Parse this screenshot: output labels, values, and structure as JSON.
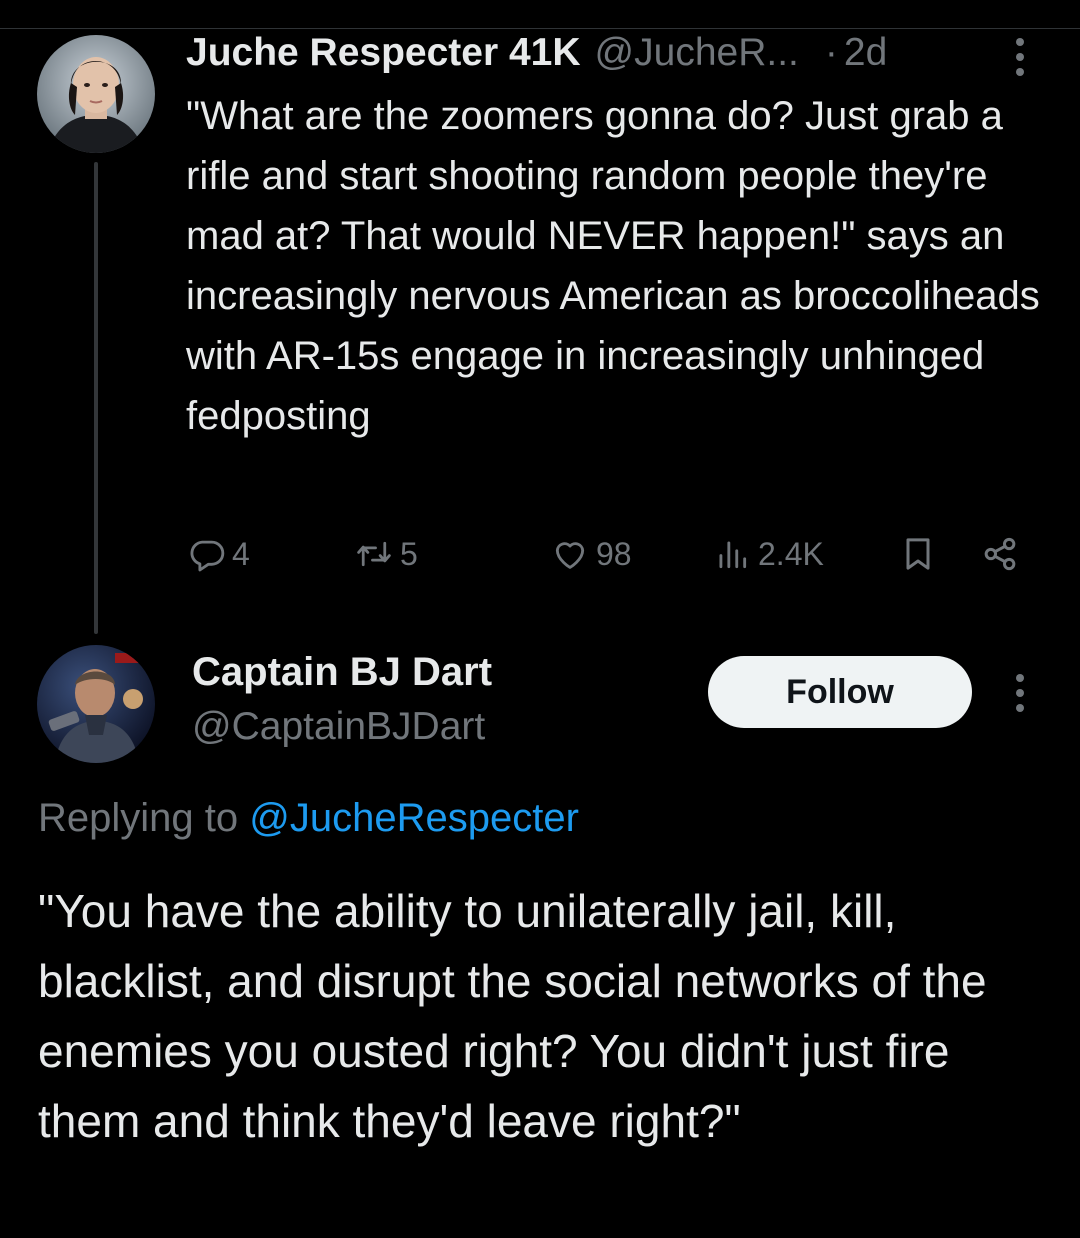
{
  "tweet1": {
    "author_name": "Juche Respecter 41K",
    "handle": "@JucheR...",
    "separator": "·",
    "time": "2d",
    "avatar_icon": "user-avatar-photo",
    "text": "\"What are the zoomers gonna do? Just grab a rifle and start shooting random people they're mad at? That would NEVER happen!\" says an increasingly nervous American as broccoliheads with AR-15s engage in increasingly unhinged fedposting",
    "stats": {
      "replies": "4",
      "reposts": "5",
      "likes": "98",
      "views": "2.4K"
    }
  },
  "tweet2": {
    "author_name": "Captain BJ Dart",
    "handle": "@CaptainBJDart",
    "avatar_icon": "user-avatar-photo",
    "follow_label": "Follow",
    "replying_prefix": "Replying to",
    "replying_to": "@JucheRespecter",
    "text": "\"You have the ability to unilaterally jail, kill, blacklist, and disrupt the social networks of the enemies you ousted right? You didn't just fire them and think they'd leave right?\""
  },
  "colors": {
    "background": "#000000",
    "text_primary": "#e7e9ea",
    "text_secondary": "#71767b",
    "link": "#1d9bf0",
    "button_bg": "#eff3f4"
  }
}
